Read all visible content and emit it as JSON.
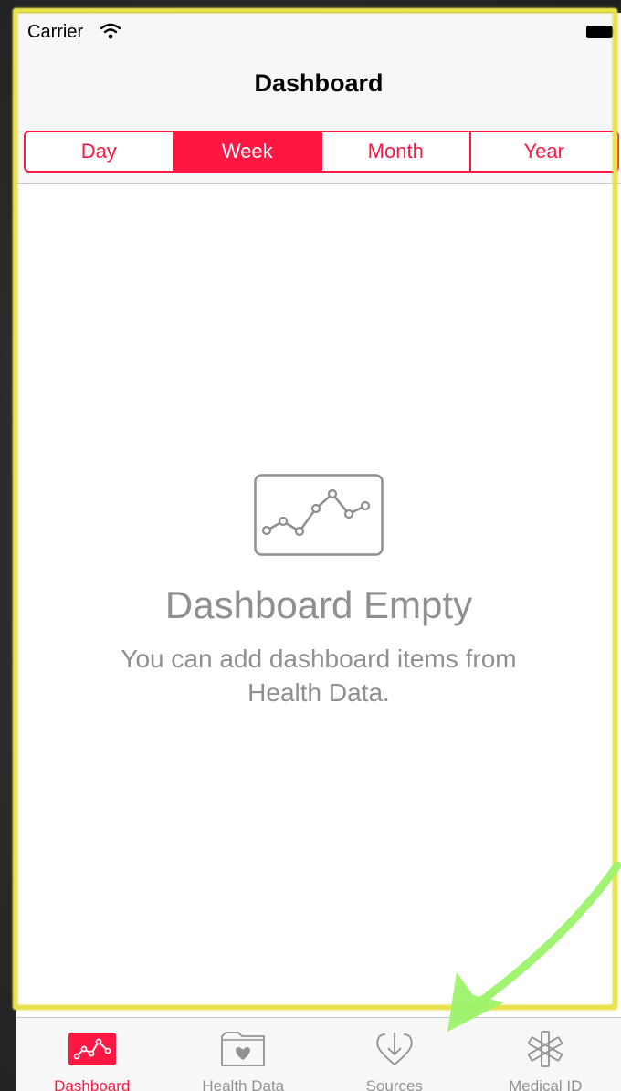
{
  "status_bar": {
    "carrier": "Carrier",
    "wifi_icon": "wifi-icon",
    "battery_icon": "battery-icon"
  },
  "nav": {
    "title": "Dashboard"
  },
  "segments": {
    "items": [
      "Day",
      "Week",
      "Month",
      "Year"
    ],
    "selected": "Week",
    "accent_color": "#ff1744"
  },
  "empty_state": {
    "icon": "line-chart-icon",
    "title": "Dashboard Empty",
    "subtitle": "You can add dashboard items from Health Data."
  },
  "tab_bar": {
    "tabs": [
      {
        "label": "Dashboard",
        "icon": "dashboard-chart-icon",
        "active": true
      },
      {
        "label": "Health Data",
        "icon": "heart-folder-icon",
        "active": false
      },
      {
        "label": "Sources",
        "icon": "download-heart-icon",
        "active": false
      },
      {
        "label": "Medical ID",
        "icon": "medical-asterisk-icon",
        "active": false
      }
    ]
  },
  "annotations": {
    "frame_color": "#e9e24a",
    "arrow_color": "#9cf36a"
  }
}
